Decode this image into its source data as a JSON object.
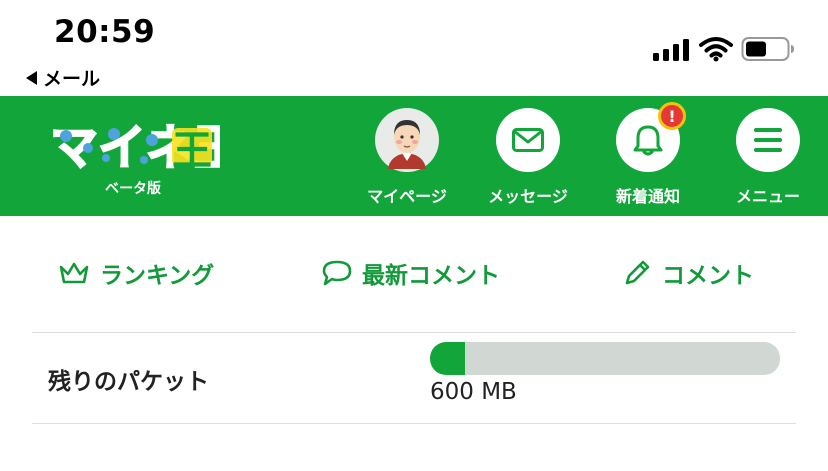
{
  "status_bar": {
    "time": "20:59",
    "back_label": "メール",
    "icons": [
      "cellular-signal-icon",
      "wifi-icon",
      "battery-icon"
    ],
    "battery_level": 0.45
  },
  "header": {
    "background": "#12a53a",
    "logo_text": "マイネ王",
    "subtitle": "ベータ版",
    "nav": [
      {
        "label": "マイページ",
        "icon": "avatar"
      },
      {
        "label": "メッセージ",
        "icon": "envelope-icon"
      },
      {
        "label": "新着通知",
        "icon": "bell-icon",
        "badge": "!"
      },
      {
        "label": "メニュー",
        "icon": "hamburger-icon"
      }
    ]
  },
  "actions": [
    {
      "label": "ランキング",
      "icon": "crown-icon"
    },
    {
      "label": "最新コメント",
      "icon": "speech-bubble-icon"
    },
    {
      "label": "コメント",
      "icon": "pencil-icon"
    }
  ],
  "packet": {
    "label": "残りのパケット",
    "amount": "600 MB",
    "fill_fraction": 0.1,
    "accent": "#12a53a"
  }
}
